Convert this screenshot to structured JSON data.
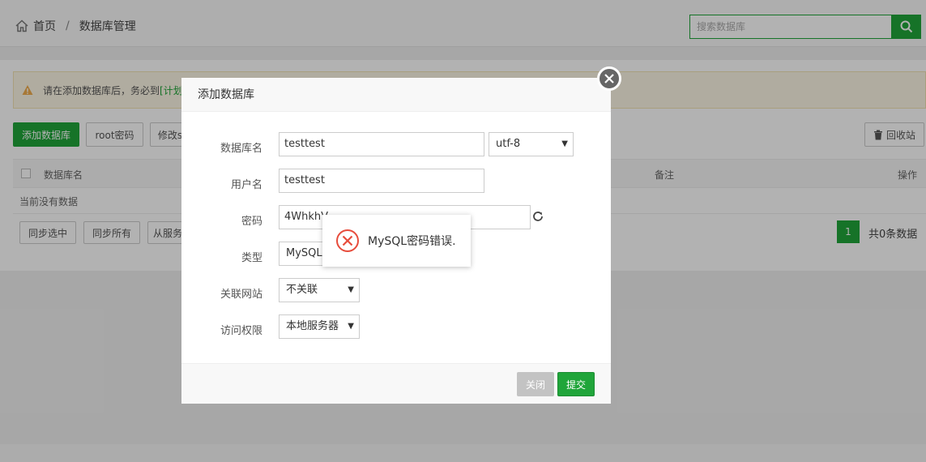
{
  "breadcrumb": {
    "home": "首页",
    "current": "数据库管理"
  },
  "search": {
    "placeholder": "搜索数据库"
  },
  "notice": {
    "text": "请在添加数据库后，务必到",
    "link": "[计划"
  },
  "toolbar": {
    "add_db": "添加数据库",
    "root_pwd": "root密码",
    "modify": "修改s",
    "recycle": "回收站"
  },
  "table": {
    "headers": [
      "数据库名",
      "备注",
      "操作"
    ],
    "empty": "当前没有数据"
  },
  "bottom_buttons": {
    "sync_selected": "同步选中",
    "sync_all": "同步所有",
    "from_server": "从服务"
  },
  "pagination": {
    "page": "1",
    "total": "共0条数据"
  },
  "modal": {
    "title": "添加数据库",
    "labels": {
      "db_name": "数据库名",
      "username": "用户名",
      "password": "密码",
      "type": "类型",
      "site": "关联网站",
      "access": "访问权限"
    },
    "values": {
      "db_name": "testtest",
      "charset": "utf-8",
      "username": "testtest",
      "password": "4WhkhV",
      "type": "MySQL",
      "site": "不关联",
      "access": "本地服务器"
    },
    "buttons": {
      "close": "关闭",
      "submit": "提交"
    }
  },
  "toast": {
    "message": "MySQL密码错误."
  },
  "colors": {
    "accent": "#20a53a",
    "error": "#e74c3c",
    "warning": "#f0ad4e"
  }
}
